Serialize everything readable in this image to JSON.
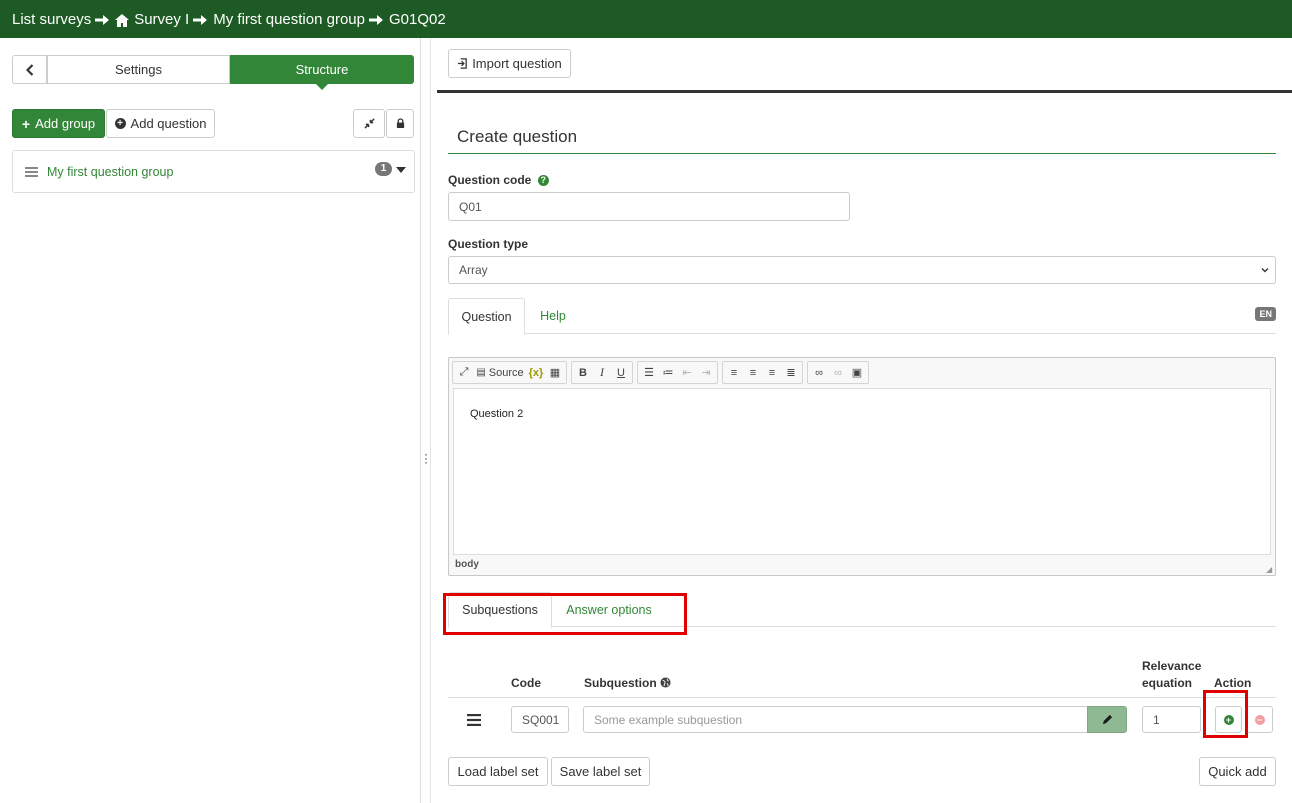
{
  "breadcrumb": {
    "items": [
      "List surveys",
      "Survey I",
      "My first question group",
      "G01Q02"
    ]
  },
  "sidebar": {
    "tabs": {
      "settings": "Settings",
      "structure": "Structure"
    },
    "add_group": "Add group",
    "add_question": "Add question",
    "group": {
      "name": "My first question group",
      "count": "1"
    }
  },
  "toolbar": {
    "import_question": "Import question"
  },
  "form": {
    "title": "Create question",
    "question_code_label": "Question code",
    "question_code_value": "Q01",
    "question_type_label": "Question type",
    "question_type_value": "Array",
    "tabs": {
      "question": "Question",
      "help": "Help"
    },
    "language": "EN"
  },
  "editor": {
    "source_label": "Source",
    "content": "Question 2",
    "path": "body"
  },
  "answers": {
    "tabs": {
      "subquestions": "Subquestions",
      "answer_options": "Answer options"
    },
    "headers": {
      "code": "Code",
      "subquestion": "Subquestion",
      "relevance_line1": "Relevance",
      "relevance_line2": "equation",
      "action": "Action"
    },
    "rows": [
      {
        "code": "SQ001",
        "placeholder": "Some example subquestion",
        "relevance": "1"
      }
    ],
    "load_label_set": "Load label set",
    "save_label_set": "Save label set",
    "quick_add": "Quick add"
  },
  "colors": {
    "brand_green": "#328637",
    "topbar_green": "#1e5b24",
    "highlight_red": "#e00000"
  }
}
